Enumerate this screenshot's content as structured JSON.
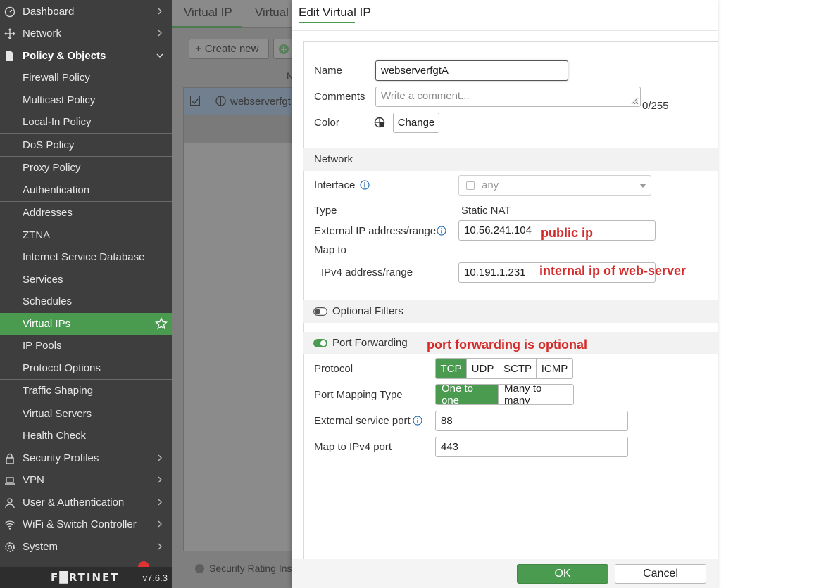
{
  "sidebar": {
    "items": [
      {
        "label": "Dashboard",
        "icon": "dashboard-icon"
      },
      {
        "label": "Network",
        "icon": "network-icon"
      },
      {
        "label": "Policy & Objects",
        "icon": "policy-icon"
      },
      {
        "label": "Firewall Policy"
      },
      {
        "label": "Multicast Policy"
      },
      {
        "label": "Local-In Policy"
      },
      {
        "label": "DoS Policy"
      },
      {
        "label": "Proxy Policy"
      },
      {
        "label": "Authentication"
      },
      {
        "label": "Addresses"
      },
      {
        "label": "ZTNA"
      },
      {
        "label": "Internet Service Database"
      },
      {
        "label": "Services"
      },
      {
        "label": "Schedules"
      },
      {
        "label": "Virtual IPs"
      },
      {
        "label": "IP Pools"
      },
      {
        "label": "Protocol Options"
      },
      {
        "label": "Traffic Shaping"
      },
      {
        "label": "Virtual Servers"
      },
      {
        "label": "Health Check"
      },
      {
        "label": "Security Profiles",
        "icon": "lock-icon"
      },
      {
        "label": "VPN",
        "icon": "laptop-icon"
      },
      {
        "label": "User & Authentication",
        "icon": "user-icon"
      },
      {
        "label": "WiFi & Switch Controller",
        "icon": "wifi-icon"
      },
      {
        "label": "System",
        "icon": "gear-icon"
      }
    ],
    "logo": "F█RTINET",
    "version": "v7.6.3"
  },
  "background": {
    "tabs": [
      "Virtual IP",
      "Virtual"
    ],
    "create_new": "Create new",
    "column_header": "N",
    "row_name": "webserverfgt",
    "security_rating": "Security Rating Insig"
  },
  "dialog": {
    "title": "Edit Virtual IP",
    "name_label": "Name",
    "name_value": "webserverfgtA",
    "comments_label": "Comments",
    "comments_placeholder": "Write a comment...",
    "comments_count": "0/255",
    "color_label": "Color",
    "color_button": "Change",
    "network_section": "Network",
    "interface_label": "Interface",
    "interface_value": "any",
    "type_label": "Type",
    "type_value": "Static NAT",
    "external_ip_label": "External IP address/range",
    "external_ip_value": "10.56.241.104",
    "external_ip_note": "public ip",
    "map_to_label": "Map to",
    "ipv4_label": "IPv4 address/range",
    "ipv4_value": "10.191.1.231",
    "ipv4_note": "internal ip of web-server",
    "optional_filters": "Optional Filters",
    "port_forwarding": "Port Forwarding",
    "port_forwarding_note": "port forwarding is optional",
    "protocol_label": "Protocol",
    "protocols": [
      "TCP",
      "UDP",
      "SCTP",
      "ICMP"
    ],
    "port_mapping_label": "Port Mapping Type",
    "port_mapping_options": [
      "One to one",
      "Many to many"
    ],
    "ext_port_label": "External service port",
    "ext_port_value": "88",
    "map_port_label": "Map to IPv4 port",
    "map_port_value": "443",
    "ok": "OK",
    "cancel": "Cancel"
  },
  "colors": {
    "accent": "#4a9a4f",
    "sidebar_bg": "#3e3e3e",
    "annotation": "#d42a2a"
  }
}
